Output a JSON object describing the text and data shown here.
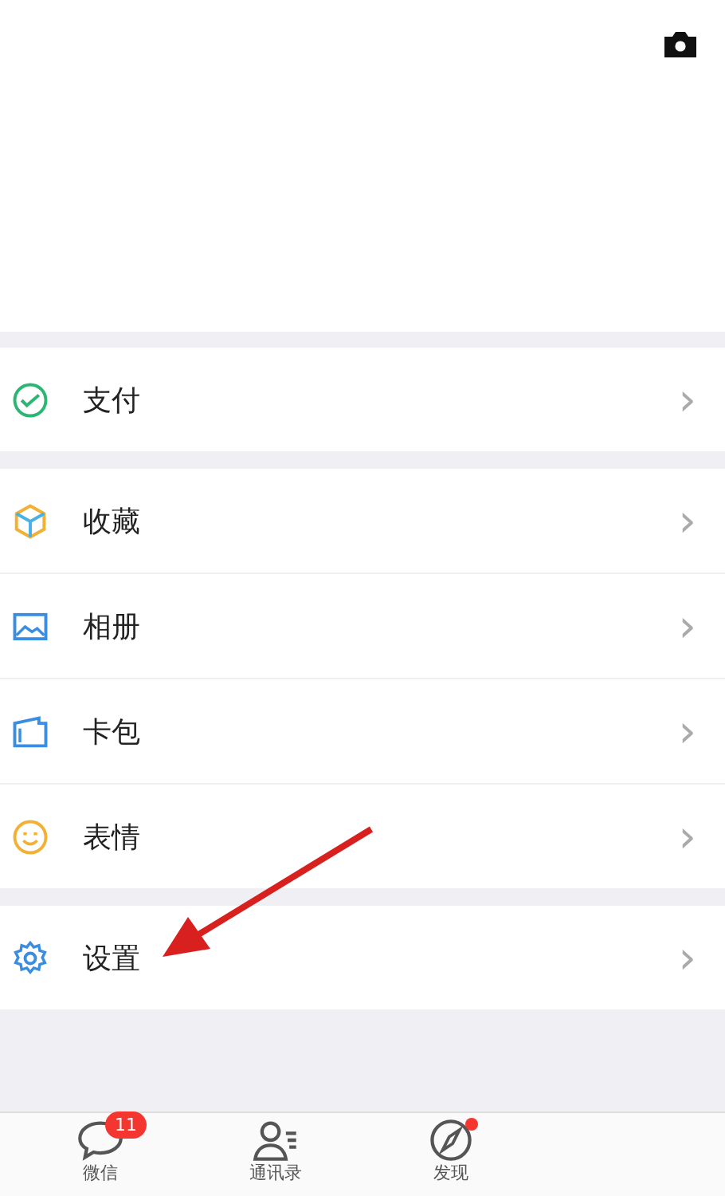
{
  "sections": [
    {
      "items": [
        {
          "label": "支付",
          "kind": "pay",
          "chevron": "›"
        }
      ]
    },
    {
      "items": [
        {
          "label": "收藏",
          "kind": "cube",
          "chevron": "›"
        },
        {
          "label": "相册",
          "kind": "photo",
          "chevron": "›"
        },
        {
          "label": "卡包",
          "kind": "wallet",
          "chevron": "›"
        },
        {
          "label": "表情",
          "kind": "smile",
          "chevron": "›"
        }
      ]
    },
    {
      "items": [
        {
          "label": "设置",
          "kind": "gear",
          "chevron": "›"
        }
      ]
    }
  ],
  "annotation": {
    "kind": "arrow"
  },
  "tabs": [
    {
      "label": "微信",
      "kind": "chat",
      "badge": "11",
      "dot": false,
      "selected": false
    },
    {
      "label": "通讯录",
      "kind": "contacts",
      "dot": false,
      "selected": false
    },
    {
      "label": "发现",
      "kind": "compass",
      "dot": true,
      "selected": false
    }
  ]
}
